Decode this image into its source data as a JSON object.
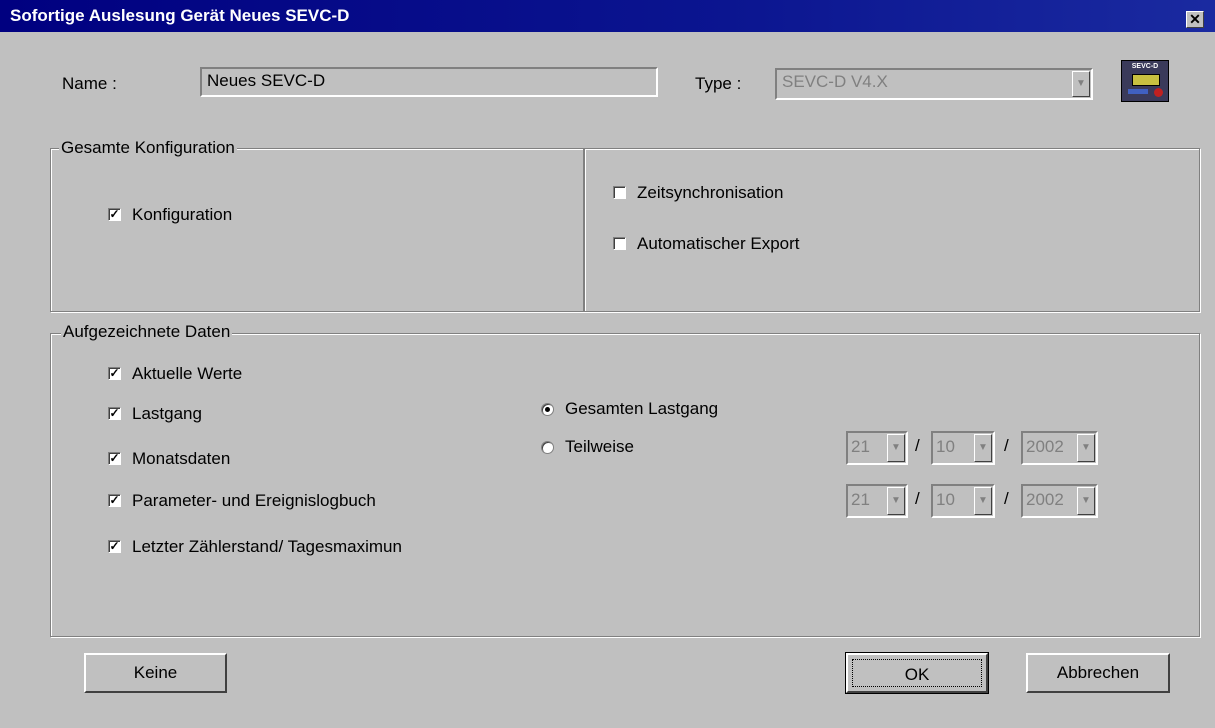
{
  "window": {
    "title": "Sofortige Auslesung Gerät Neues SEVC-D",
    "close_glyph": "✕"
  },
  "header": {
    "name_label": "Name :",
    "name_value": "Neues SEVC-D",
    "type_label": "Type :",
    "type_value": "SEVC-D V4.X",
    "device_icon_text": "SEVC-D"
  },
  "config_group": {
    "legend": "Gesamte Konfiguration",
    "konfiguration": {
      "label": "Konfiguration",
      "checked": true
    },
    "zeitsync": {
      "label": "Zeitsynchronisation",
      "checked": false
    },
    "autoexport": {
      "label": "Automatischer Export",
      "checked": false
    }
  },
  "data_group": {
    "legend": "Aufgezeichnete Daten",
    "items": [
      {
        "label": "Aktuelle Werte",
        "checked": true
      },
      {
        "label": "Lastgang",
        "checked": true
      },
      {
        "label": "Monatsdaten",
        "checked": true
      },
      {
        "label": "Parameter- und Ereignislogbuch",
        "checked": true
      },
      {
        "label": "Letzter Zählerstand/ Tagesmaximun",
        "checked": true
      }
    ],
    "radios": [
      {
        "label": "Gesamten Lastgang",
        "selected": true
      },
      {
        "label": "Teilweise",
        "selected": false
      }
    ],
    "date_from": {
      "day": "21",
      "month": "10",
      "year": "2002"
    },
    "date_to": {
      "day": "21",
      "month": "10",
      "year": "2002"
    },
    "separator": "/"
  },
  "buttons": {
    "keine": "Keine",
    "ok": "OK",
    "abbrechen": "Abbrechen"
  },
  "check_glyph": "✓"
}
